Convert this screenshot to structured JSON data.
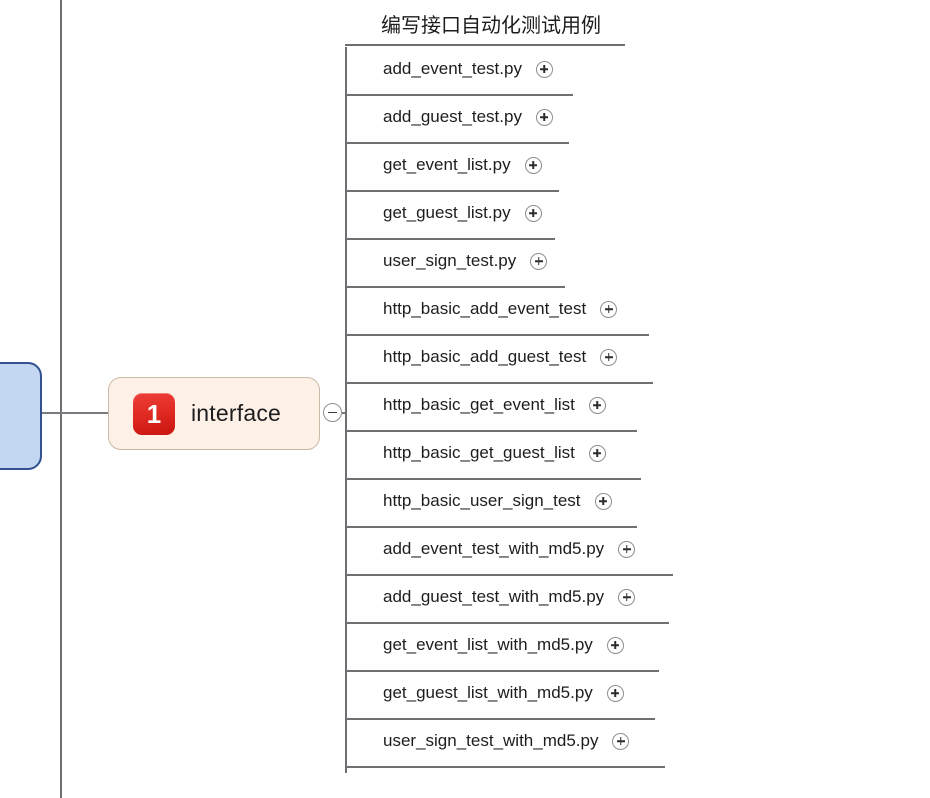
{
  "app": {
    "type": "mind-map",
    "colors": {
      "node_fill": "#fdf0e6",
      "node_border": "#c9b9a7",
      "badge_red": "#e02a22",
      "ancestor_fill": "#c3d7f2",
      "ancestor_border": "#31518f",
      "line": "#6e6e73",
      "text": "#1d1d1f"
    }
  },
  "ancestor_node": {
    "name": "parent-node",
    "label": ""
  },
  "node": {
    "badge": "1",
    "label": "interface",
    "toggle_icon": "minus-circle-icon",
    "toggle_state": "expanded"
  },
  "branch": {
    "title": "编写接口自动化测试用例",
    "item_toggle_icon": "plus-circle-icon",
    "items": [
      {
        "label": "add_event_test.py",
        "rule_width": 228
      },
      {
        "label": "add_guest_test.py",
        "rule_width": 224
      },
      {
        "label": "get_event_list.py",
        "rule_width": 214
      },
      {
        "label": "get_guest_list.py",
        "rule_width": 210
      },
      {
        "label": "user_sign_test.py",
        "rule_width": 220
      },
      {
        "label": "http_basic_add_event_test",
        "rule_width": 304
      },
      {
        "label": "http_basic_add_guest_test",
        "rule_width": 308
      },
      {
        "label": "http_basic_get_event_list",
        "rule_width": 292
      },
      {
        "label": "http_basic_get_guest_list",
        "rule_width": 296
      },
      {
        "label": "http_basic_user_sign_test",
        "rule_width": 292
      },
      {
        "label": "add_event_test_with_md5.py",
        "rule_width": 328
      },
      {
        "label": "add_guest_test_with_md5.py",
        "rule_width": 324
      },
      {
        "label": "get_event_list_with_md5.py",
        "rule_width": 314
      },
      {
        "label": "get_guest_list_with_md5.py",
        "rule_width": 310
      },
      {
        "label": "user_sign_test_with_md5.py",
        "rule_width": 320
      }
    ]
  }
}
